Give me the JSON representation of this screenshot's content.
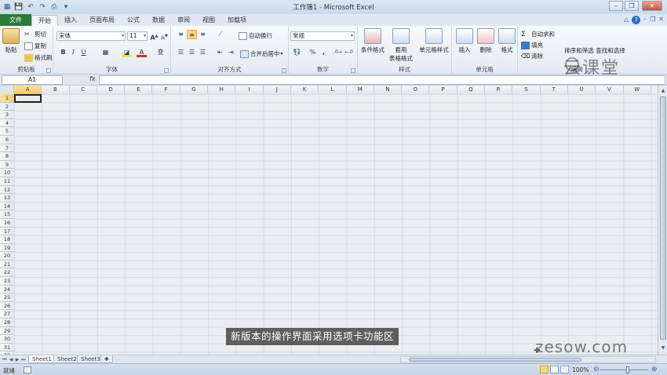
{
  "window": {
    "title": "工作簿1 - Microsoft Excel",
    "colors": {
      "file_tab": "#2c7a3a",
      "selection": "#f4c865"
    }
  },
  "tabs": {
    "file": "文件",
    "items": [
      "开始",
      "插入",
      "页面布局",
      "公式",
      "数据",
      "审阅",
      "视图",
      "加载项"
    ],
    "active": "开始"
  },
  "ribbon": {
    "clipboard": {
      "paste": "粘贴",
      "cut": "剪切",
      "copy": "复制",
      "format_painter": "格式刷",
      "label": "剪贴板"
    },
    "font": {
      "name": "宋体",
      "size": "11",
      "bold": "B",
      "italic": "I",
      "underline": "U",
      "label": "字体"
    },
    "alignment": {
      "wrap_text": "自动换行",
      "merge": "合并后居中",
      "label": "对齐方式"
    },
    "number": {
      "format": "常规",
      "percent": "%",
      "comma": ",",
      "label": "数字"
    },
    "styles": {
      "conditional": "条件格式",
      "table_line1": "套用",
      "table_line2": "表格格式",
      "cell_styles": "单元格样式",
      "label": "样式"
    },
    "cells": {
      "insert": "插入",
      "delete": "删除",
      "format": "格式",
      "label": "单元格"
    },
    "editing": {
      "autosum": "自动求和",
      "fill": "填充",
      "clear": "清除",
      "sort_filter": "排序和筛选",
      "find_select": "查找和选择",
      "label": "编辑"
    }
  },
  "formula_bar": {
    "name_box": "A1",
    "fx": "fx",
    "value": ""
  },
  "grid": {
    "columns": [
      "A",
      "B",
      "C",
      "D",
      "E",
      "F",
      "G",
      "H",
      "I",
      "J",
      "K",
      "L",
      "M",
      "N",
      "O",
      "P",
      "Q",
      "R",
      "S",
      "T",
      "U",
      "V",
      "W"
    ],
    "rows": [
      "1",
      "2",
      "3",
      "4",
      "5",
      "6",
      "7",
      "8",
      "9",
      "10",
      "11",
      "12",
      "13",
      "14",
      "15",
      "16",
      "17",
      "18",
      "19",
      "20",
      "21",
      "22",
      "23",
      "24",
      "25",
      "26",
      "27",
      "28",
      "29",
      "30",
      "31",
      "32"
    ],
    "active_cell": "A1"
  },
  "sheets": {
    "items": [
      "Sheet1",
      "Sheet2",
      "Sheet3"
    ],
    "active": "Sheet1"
  },
  "status": {
    "text": "就绪",
    "zoom": "100%"
  },
  "overlay": {
    "subtitle": "新版本的操作界面采用选项卡功能区",
    "watermark": "zesow.com",
    "logo": "云课堂"
  }
}
